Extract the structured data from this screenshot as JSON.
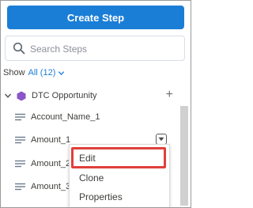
{
  "toolbar": {
    "create_label": "Create Step"
  },
  "search": {
    "placeholder": "Search Steps"
  },
  "show": {
    "prefix": "Show",
    "filter_label": "All (12)"
  },
  "group": {
    "label": "DTC Opportunity",
    "add_symbol": "+"
  },
  "fields": [
    {
      "name": "Account_Name_1"
    },
    {
      "name": "Amount_1"
    },
    {
      "name": "Amount_2"
    },
    {
      "name": "Amount_3"
    }
  ],
  "menu": {
    "items": [
      {
        "label": "Edit"
      },
      {
        "label": "Clone"
      },
      {
        "label": "Properties"
      }
    ]
  },
  "colors": {
    "primary": "#1b7ed6",
    "group_icon": "#8a56c9",
    "highlight": "#e0403a"
  },
  "icons": {
    "search": "search-icon",
    "chevron": "chevron-down-icon",
    "group": "hexagon-icon",
    "field": "field-lines-icon"
  }
}
